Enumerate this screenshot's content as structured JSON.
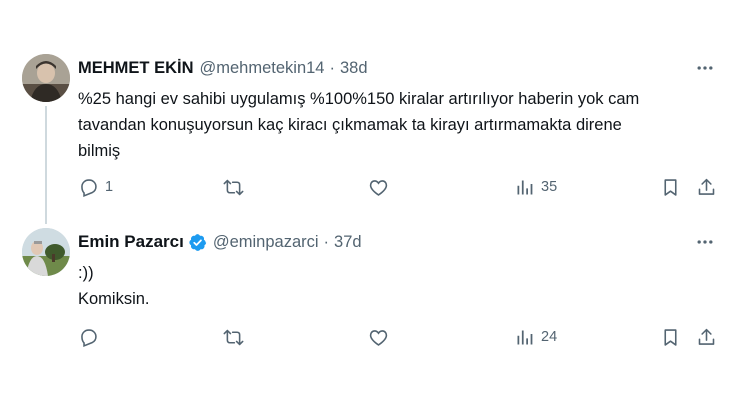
{
  "tweets": [
    {
      "author_name": "MEHMET EKİN",
      "handle": "@mehmetekin14",
      "separator": "·",
      "time": "38d",
      "text_lines": [
        "%25 hangi ev sahibi uygulamış %100%150 kiralar artırılıyor haberin yok cam",
        "tavandan konuşuyorsun kaç kiracı çıkmamak ta  kirayı artırmamakta direne",
        "bilmiş"
      ],
      "verified": false,
      "replies": "1",
      "retweets": "",
      "likes": "",
      "views": "35"
    },
    {
      "author_name": "Emin Pazarcı",
      "handle": "@eminpazarci",
      "separator": "·",
      "time": "37d",
      "text_lines": [
        ":))",
        "Komiksin."
      ],
      "verified": true,
      "replies": "",
      "retweets": "",
      "likes": "",
      "views": "24"
    }
  ],
  "icons": {
    "reply": "reply-icon",
    "retweet": "retweet-icon",
    "like": "heart-icon",
    "views": "views-icon",
    "bookmark": "bookmark-icon",
    "share": "share-icon",
    "more": "more-icon",
    "verified": "verified-badge-icon"
  },
  "colors": {
    "text": "#0f1419",
    "secondary": "#536471",
    "thread_line": "#cfd9de",
    "verified": "#1d9bf0"
  }
}
